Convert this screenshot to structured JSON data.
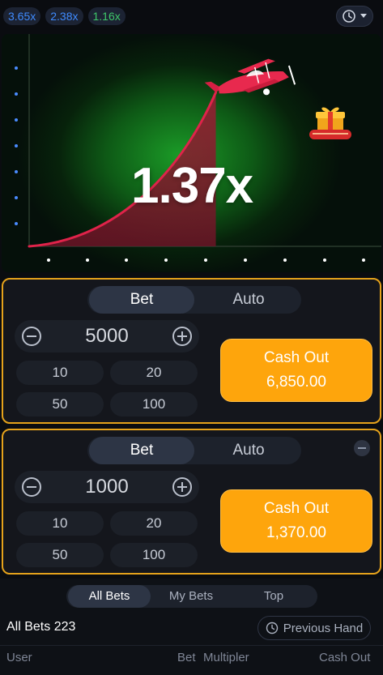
{
  "history": {
    "chips": [
      {
        "value": "3.65x",
        "tone": "blue"
      },
      {
        "value": "2.38x",
        "tone": "blue"
      },
      {
        "value": "1.16x",
        "tone": "green"
      }
    ],
    "history_icon": "clock-history-icon"
  },
  "game": {
    "multiplier": "1.37x",
    "progress": 0.68,
    "plane_icon": "red-biplane-icon",
    "gift_icon": "gift-box-icon",
    "colors": {
      "curve": "#e0234a",
      "fill": "#8c1a30",
      "glow": "#1b9b27"
    }
  },
  "panels": [
    {
      "tabs": {
        "bet": "Bet",
        "auto": "Auto"
      },
      "amount": "5000",
      "quick": [
        "10",
        "20",
        "50",
        "100"
      ],
      "cashout": {
        "label": "Cash Out",
        "value": "6,850.00"
      }
    },
    {
      "tabs": {
        "bet": "Bet",
        "auto": "Auto"
      },
      "amount": "1000",
      "quick": [
        "10",
        "20",
        "50",
        "100"
      ],
      "cashout": {
        "label": "Cash Out",
        "value": "1,370.00"
      }
    }
  ],
  "bets": {
    "tabs": [
      "All Bets",
      "My Bets",
      "Top"
    ],
    "count_label": "All Bets 223",
    "prev_hand": "Previous Hand",
    "columns": {
      "user": "User",
      "bet": "Bet",
      "multiplier": "Multipler",
      "cashout": "Cash Out"
    }
  },
  "colors": {
    "accent": "#fea50c",
    "panel_border": "#e5a21b"
  }
}
